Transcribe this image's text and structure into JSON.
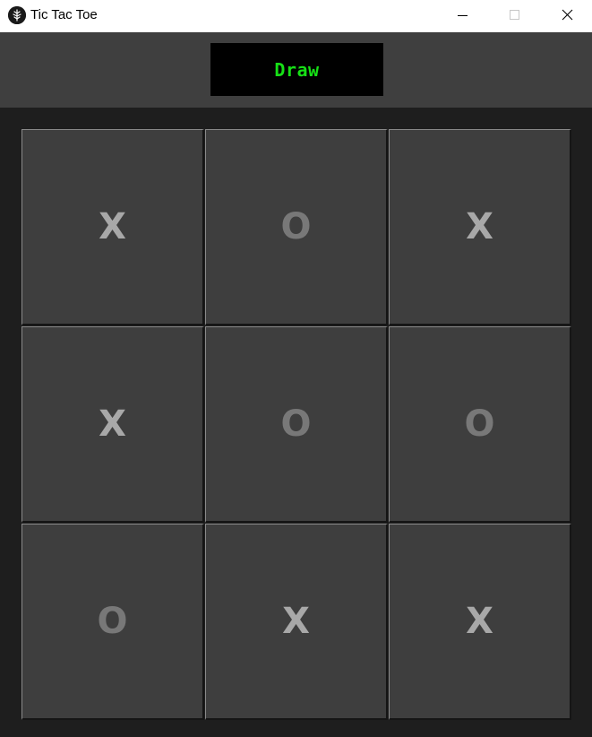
{
  "window": {
    "title": "Tic Tac Toe",
    "icon": "feather-icon"
  },
  "header": {
    "status": "Draw"
  },
  "colors": {
    "status_text": "#16e016",
    "x_mark": "#a8a8a8",
    "o_mark": "#787878",
    "cell_bg": "#3e3e3e",
    "header_bg": "#3f3f3f",
    "board_bg": "#1e1e1e"
  },
  "board": {
    "cells": [
      "X",
      "O",
      "X",
      "X",
      "O",
      "O",
      "O",
      "X",
      "X"
    ]
  }
}
